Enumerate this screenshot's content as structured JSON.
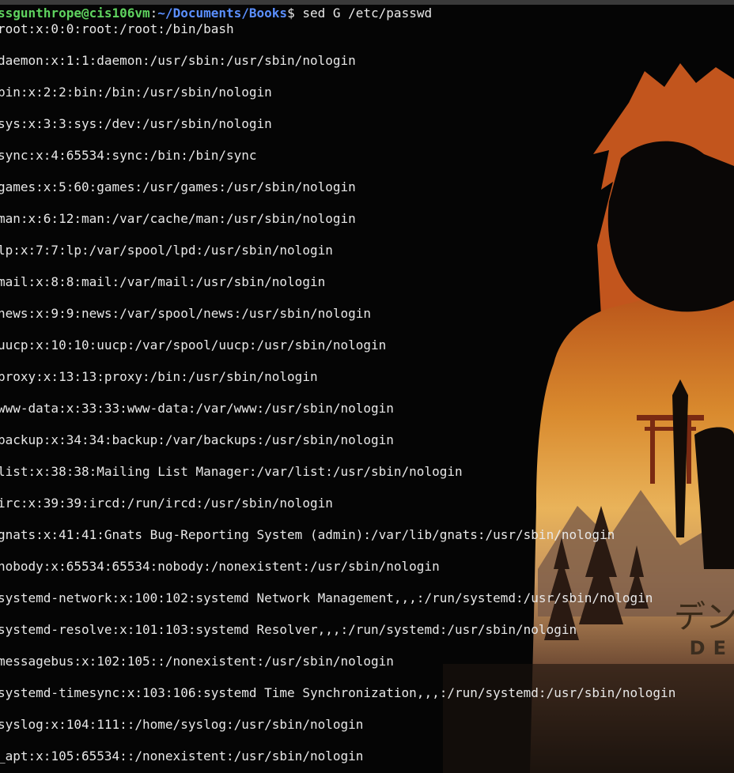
{
  "prompt": {
    "user_host": "ssgunthrope@cis106vm",
    "sep": ":",
    "path": "~/Documents/Books",
    "dollar": "$",
    "command": " sed G /etc/passwd"
  },
  "wallpaper": {
    "jp_text": "デン",
    "en_text": "DE"
  },
  "output_lines": [
    "root:x:0:0:root:/root:/bin/bash",
    "",
    "daemon:x:1:1:daemon:/usr/sbin:/usr/sbin/nologin",
    "",
    "bin:x:2:2:bin:/bin:/usr/sbin/nologin",
    "",
    "sys:x:3:3:sys:/dev:/usr/sbin/nologin",
    "",
    "sync:x:4:65534:sync:/bin:/bin/sync",
    "",
    "games:x:5:60:games:/usr/games:/usr/sbin/nologin",
    "",
    "man:x:6:12:man:/var/cache/man:/usr/sbin/nologin",
    "",
    "lp:x:7:7:lp:/var/spool/lpd:/usr/sbin/nologin",
    "",
    "mail:x:8:8:mail:/var/mail:/usr/sbin/nologin",
    "",
    "news:x:9:9:news:/var/spool/news:/usr/sbin/nologin",
    "",
    "uucp:x:10:10:uucp:/var/spool/uucp:/usr/sbin/nologin",
    "",
    "proxy:x:13:13:proxy:/bin:/usr/sbin/nologin",
    "",
    "www-data:x:33:33:www-data:/var/www:/usr/sbin/nologin",
    "",
    "backup:x:34:34:backup:/var/backups:/usr/sbin/nologin",
    "",
    "list:x:38:38:Mailing List Manager:/var/list:/usr/sbin/nologin",
    "",
    "irc:x:39:39:ircd:/run/ircd:/usr/sbin/nologin",
    "",
    "gnats:x:41:41:Gnats Bug-Reporting System (admin):/var/lib/gnats:/usr/sbin/nologin",
    "",
    "nobody:x:65534:65534:nobody:/nonexistent:/usr/sbin/nologin",
    "",
    "systemd-network:x:100:102:systemd Network Management,,,:/run/systemd:/usr/sbin/nologin",
    "",
    "systemd-resolve:x:101:103:systemd Resolver,,,:/run/systemd:/usr/sbin/nologin",
    "",
    "messagebus:x:102:105::/nonexistent:/usr/sbin/nologin",
    "",
    "systemd-timesync:x:103:106:systemd Time Synchronization,,,:/run/systemd:/usr/sbin/nologin",
    "",
    "syslog:x:104:111::/home/syslog:/usr/sbin/nologin",
    "",
    "_apt:x:105:65534::/nonexistent:/usr/sbin/nologin"
  ]
}
